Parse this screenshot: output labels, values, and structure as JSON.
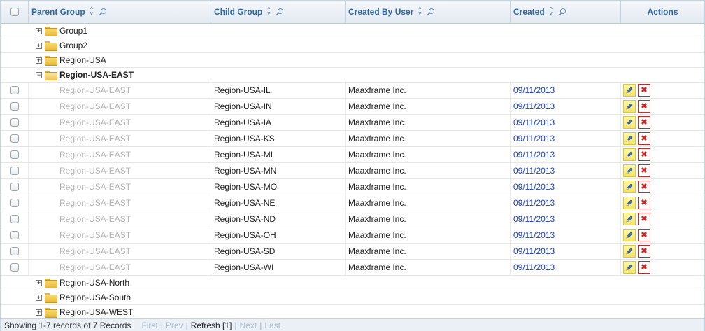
{
  "header": {
    "columns": [
      {
        "label": ""
      },
      {
        "label": "Parent Group"
      },
      {
        "label": "Child Group"
      },
      {
        "label": "Created By User"
      },
      {
        "label": "Created"
      },
      {
        "label": "Actions"
      }
    ]
  },
  "groups_top": [
    {
      "label": "Group1",
      "toggle": "+"
    },
    {
      "label": "Group2",
      "toggle": "+"
    },
    {
      "label": "Region-USA",
      "toggle": "+"
    },
    {
      "label": "Region-USA-EAST",
      "toggle": "−"
    }
  ],
  "rows": [
    {
      "parent": "Region-USA-EAST",
      "child": "Region-USA-IL",
      "user": "Maaxframe Inc.",
      "created": "09/11/2013"
    },
    {
      "parent": "Region-USA-EAST",
      "child": "Region-USA-IN",
      "user": "Maaxframe Inc.",
      "created": "09/11/2013"
    },
    {
      "parent": "Region-USA-EAST",
      "child": "Region-USA-IA",
      "user": "Maaxframe Inc.",
      "created": "09/11/2013"
    },
    {
      "parent": "Region-USA-EAST",
      "child": "Region-USA-KS",
      "user": "Maaxframe Inc.",
      "created": "09/11/2013"
    },
    {
      "parent": "Region-USA-EAST",
      "child": "Region-USA-MI",
      "user": "Maaxframe Inc.",
      "created": "09/11/2013"
    },
    {
      "parent": "Region-USA-EAST",
      "child": "Region-USA-MN",
      "user": "Maaxframe Inc.",
      "created": "09/11/2013"
    },
    {
      "parent": "Region-USA-EAST",
      "child": "Region-USA-MO",
      "user": "Maaxframe Inc.",
      "created": "09/11/2013"
    },
    {
      "parent": "Region-USA-EAST",
      "child": "Region-USA-NE",
      "user": "Maaxframe Inc.",
      "created": "09/11/2013"
    },
    {
      "parent": "Region-USA-EAST",
      "child": "Region-USA-ND",
      "user": "Maaxframe Inc.",
      "created": "09/11/2013"
    },
    {
      "parent": "Region-USA-EAST",
      "child": "Region-USA-OH",
      "user": "Maaxframe Inc.",
      "created": "09/11/2013"
    },
    {
      "parent": "Region-USA-EAST",
      "child": "Region-USA-SD",
      "user": "Maaxframe Inc.",
      "created": "09/11/2013"
    },
    {
      "parent": "Region-USA-EAST",
      "child": "Region-USA-WI",
      "user": "Maaxframe Inc.",
      "created": "09/11/2013"
    }
  ],
  "groups_bottom": [
    {
      "label": "Region-USA-North",
      "toggle": "+"
    },
    {
      "label": "Region-USA-South",
      "toggle": "+"
    },
    {
      "label": "Region-USA-WEST",
      "toggle": "+"
    }
  ],
  "footer": {
    "status": "Showing 1-7 records of 7 Records",
    "first": "First",
    "prev": "Prev",
    "refresh": "Refresh [1]",
    "next": "Next",
    "last": "Last",
    "sep": "|"
  },
  "colors": {
    "header_text": "#2e6aa8",
    "date_text": "#1a3fd1",
    "muted_text": "#b4b4b4",
    "delete_red": "#c42b2b",
    "edit_yellow": "#f4e26a"
  },
  "icons": {
    "sort": "sort-arrows-icon",
    "filter": "magnifier-icon",
    "folder": "folder-icon",
    "edit": "pencil-icon",
    "delete": "close-x-icon"
  }
}
